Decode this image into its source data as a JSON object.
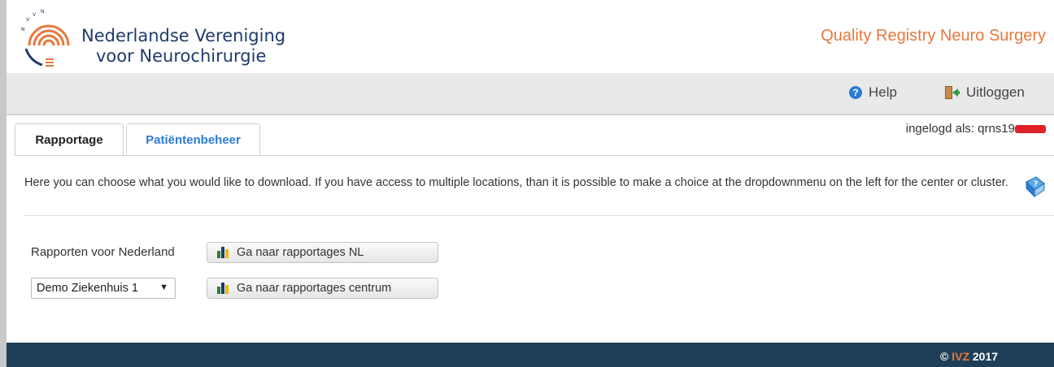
{
  "header": {
    "org_line1": "Nederlandse Vereniging",
    "org_line2": "voor Neurochirurgie",
    "app_title": "Quality Registry Neuro Surgery",
    "logo_icon": "nvvn-logo-icon"
  },
  "toolbar": {
    "help_label": "Help",
    "logout_label": "Uitloggen",
    "help_icon": "help-icon",
    "logout_icon": "logout-door-icon"
  },
  "tabs": [
    {
      "label": "Rapportage",
      "active": true
    },
    {
      "label": "Patiëntenbeheer",
      "active": false
    }
  ],
  "user": {
    "logged_in_text": "ingelogd als: qrns19"
  },
  "main": {
    "intro": "Here you can choose what you would like to download. If you have access to multiple locations, than it is possible to make a choice at the dropdownmenu on the left for the center or cluster.",
    "nl_label": "Rapporten voor Nederland",
    "btn_nl": "Ga naar rapportages NL",
    "location_select": "Demo Ziekenhuis 1",
    "btn_centrum": "Ga naar rapportages centrum"
  },
  "footer": {
    "copyright_symbol": "©",
    "brand": "IVZ",
    "year": "2017"
  },
  "colors": {
    "accent_orange": "#e8783c",
    "footer_bg": "#1e3f57",
    "link_blue": "#2b7bd6"
  }
}
